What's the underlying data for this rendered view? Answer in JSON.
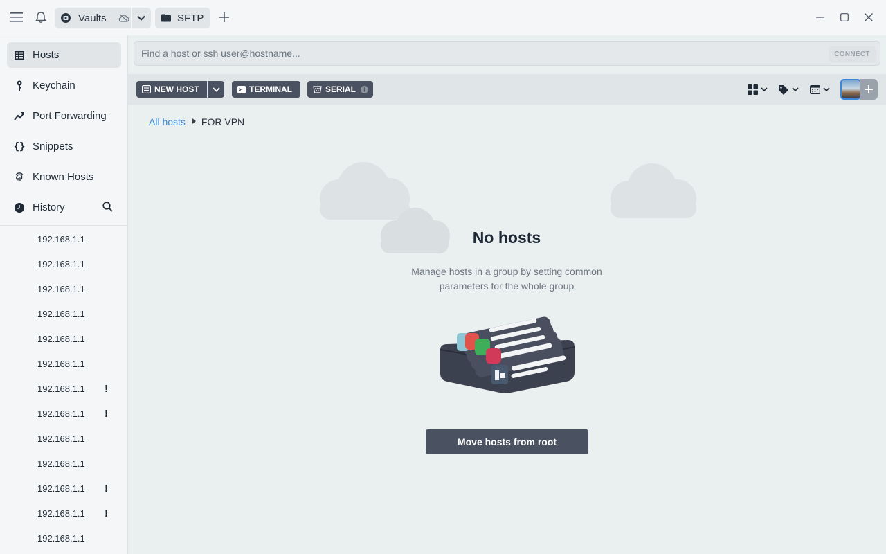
{
  "titlebar": {
    "tabs": [
      {
        "label": "Vaults",
        "icon": "vault-icon"
      },
      {
        "label": "SFTP",
        "icon": "folder-icon"
      }
    ]
  },
  "sidebar": {
    "nav": [
      {
        "label": "Hosts",
        "icon": "hosts-grid-icon",
        "active": true
      },
      {
        "label": "Keychain",
        "icon": "key-icon"
      },
      {
        "label": "Port Forwarding",
        "icon": "port-forwarding-icon"
      },
      {
        "label": "Snippets",
        "icon": "braces-icon"
      },
      {
        "label": "Known Hosts",
        "icon": "fingerprint-icon"
      },
      {
        "label": "History",
        "icon": "clock-icon"
      }
    ],
    "history": [
      {
        "host": "192.168.1.1",
        "warning": false
      },
      {
        "host": "192.168.1.1",
        "warning": false
      },
      {
        "host": "192.168.1.1",
        "warning": false
      },
      {
        "host": "192.168.1.1",
        "warning": false
      },
      {
        "host": "192.168.1.1",
        "warning": false
      },
      {
        "host": "192.168.1.1",
        "warning": false
      },
      {
        "host": "192.168.1.1",
        "warning": true
      },
      {
        "host": "192.168.1.1",
        "warning": true
      },
      {
        "host": "192.168.1.1",
        "warning": false
      },
      {
        "host": "192.168.1.1",
        "warning": false
      },
      {
        "host": "192.168.1.1",
        "warning": true
      },
      {
        "host": "192.168.1.1",
        "warning": true
      },
      {
        "host": "192.168.1.1",
        "warning": false
      }
    ],
    "warning_mark": "!"
  },
  "search": {
    "placeholder": "Find a host or ssh user@hostname...",
    "value": "",
    "connect_label": "CONNECT"
  },
  "toolbar": {
    "new_host_label": "NEW HOST",
    "terminal_label": "TERMINAL",
    "serial_label": "SERIAL"
  },
  "breadcrumb": {
    "root": "All hosts",
    "current": "FOR VPN"
  },
  "empty_state": {
    "title": "No hosts",
    "description": "Manage hosts in a group by setting common parameters for the whole group",
    "action_label": "Move hosts from root"
  },
  "colors": {
    "accent": "#3a86d8",
    "button_dark": "#4a5160",
    "background": "#eaeff0"
  }
}
